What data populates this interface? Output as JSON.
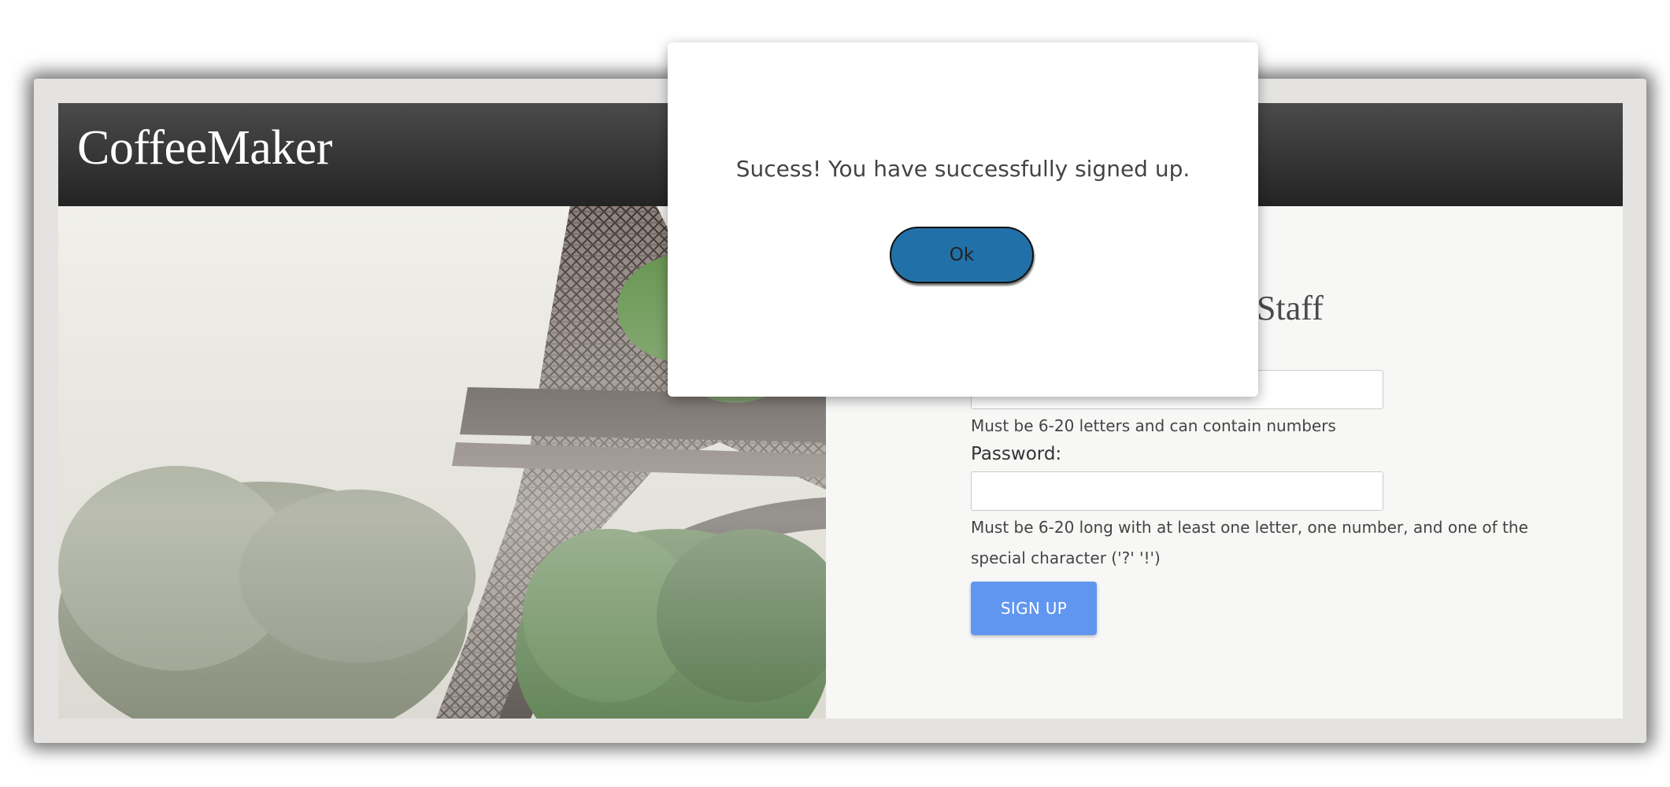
{
  "app": {
    "title": "CoffeeMaker"
  },
  "signup_form": {
    "title": "Staff",
    "username_value": "",
    "username_hint": "Must be 6-20 letters and can contain numbers",
    "password_label": "Password:",
    "password_value": "",
    "password_hint_line1": "Must be 6-20 long with at least one letter, one number, and one of the",
    "password_hint_line2": "special character ('?' '!')",
    "submit_label": "SIGN UP"
  },
  "dialog": {
    "message": "Sucess! You have successfully signed up.",
    "ok_label": "Ok"
  },
  "colors": {
    "header_bg": "#2e2e2e",
    "signup_button": "#6196f0",
    "ok_button": "#2270a8",
    "panel_bg": "#f7f7f6"
  },
  "icons": {
    "photo": "eiffel-tower-photo"
  }
}
